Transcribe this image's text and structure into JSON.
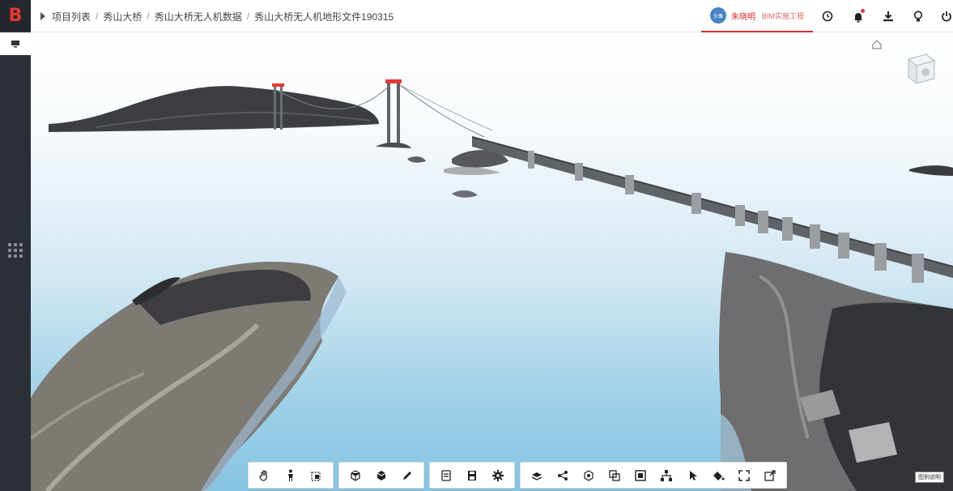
{
  "app": {
    "logo_text": "B"
  },
  "breadcrumb": [
    "项目列表",
    "秀山大桥",
    "秀山大桥无人机数据",
    "秀山大桥无人机地形文件190315"
  ],
  "breadcrumb_separator": "/",
  "user": {
    "avatar_text": "头像",
    "name": "朱晓明",
    "role": "BIM实施工程"
  },
  "viewport": {
    "status_tag": "图例说明"
  },
  "colors": {
    "accent": "#d32f2f",
    "rail": "#2b2f38",
    "sky_top": "#ffffff",
    "water": "#86c4e2"
  },
  "icons": {
    "top": [
      "clock-icon",
      "bell-icon",
      "download-icon",
      "lightbulb-icon",
      "power-icon"
    ],
    "toolbar": [
      [
        "hand-icon",
        "person-walk-icon",
        "frame-select-icon"
      ],
      [
        "cube-rotate-icon",
        "cube-section-icon",
        "pen-icon"
      ],
      [
        "layers-icon",
        "save-icon",
        "gear-icon"
      ],
      [
        "stack-icon",
        "share-icon",
        "model-icon",
        "overlap-icon",
        "box-icon",
        "tree-icon",
        "cursor-icon",
        "paint-bucket-icon",
        "fullscreen-icon",
        "export-icon"
      ]
    ]
  }
}
